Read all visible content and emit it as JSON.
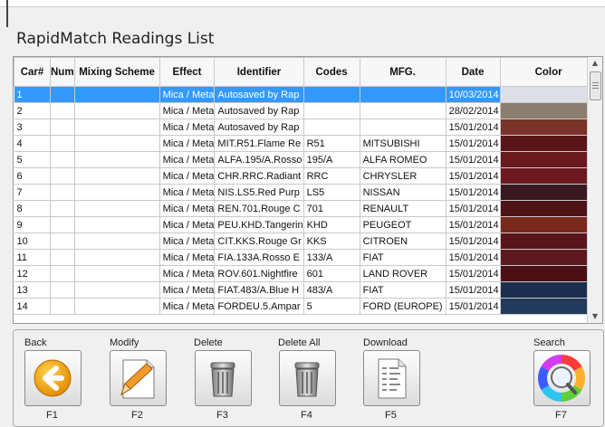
{
  "title": "RapidMatch Readings List",
  "columns": [
    "Car#",
    "Num",
    "Mixing Scheme",
    "Effect",
    "Identifier",
    "Codes",
    "MFG.",
    "Date",
    "Color"
  ],
  "rows": [
    {
      "car": "1",
      "num": "",
      "scheme": "",
      "effect": "Mica / Meta",
      "identifier": "Autosaved by Rap",
      "code": "",
      "mfg": "",
      "date": "10/03/2014",
      "color": "#dde0e8",
      "selected": true
    },
    {
      "car": "2",
      "num": "",
      "scheme": "",
      "effect": "Mica / Meta",
      "identifier": "Autosaved by Rap",
      "code": "",
      "mfg": "",
      "date": "28/02/2014",
      "color": "#8b7e6e",
      "selected": false
    },
    {
      "car": "3",
      "num": "",
      "scheme": "",
      "effect": "Mica / Meta",
      "identifier": "Autosaved by Rap",
      "code": "",
      "mfg": "",
      "date": "15/01/2014",
      "color": "#7a3328",
      "selected": false
    },
    {
      "car": "4",
      "num": "",
      "scheme": "",
      "effect": "Mica / Meta",
      "identifier": "MIT.R51.Flame Re",
      "code": "R51",
      "mfg": "MITSUBISHI",
      "date": "15/01/2014",
      "color": "#5a1518",
      "selected": false
    },
    {
      "car": "5",
      "num": "",
      "scheme": "",
      "effect": "Mica / Meta",
      "identifier": "ALFA.195/A.Rosso",
      "code": "195/A",
      "mfg": "ALFA ROMEO",
      "date": "15/01/2014",
      "color": "#6a1a1e",
      "selected": false
    },
    {
      "car": "6",
      "num": "",
      "scheme": "",
      "effect": "Mica / Meta",
      "identifier": "CHR.RRC.Radiant",
      "code": "RRC",
      "mfg": "CHRYSLER",
      "date": "15/01/2014",
      "color": "#6e1820",
      "selected": false
    },
    {
      "car": "7",
      "num": "",
      "scheme": "",
      "effect": "Mica / Meta",
      "identifier": "NIS.LS5.Red Purp",
      "code": "LS5",
      "mfg": "NISSAN",
      "date": "15/01/2014",
      "color": "#3a1820",
      "selected": false
    },
    {
      "car": "8",
      "num": "",
      "scheme": "",
      "effect": "Mica / Meta",
      "identifier": "REN.701.Rouge C",
      "code": "701",
      "mfg": "RENAULT",
      "date": "15/01/2014",
      "color": "#4e1418",
      "selected": false
    },
    {
      "car": "9",
      "num": "",
      "scheme": "",
      "effect": "Mica / Meta",
      "identifier": "PEU.KHD.Tangerin",
      "code": "KHD",
      "mfg": "PEUGEOT",
      "date": "15/01/2014",
      "color": "#7a2a1c",
      "selected": false
    },
    {
      "car": "10",
      "num": "",
      "scheme": "",
      "effect": "Mica / Meta",
      "identifier": "CIT.KKS.Rouge Gr",
      "code": "KKS",
      "mfg": "CITROEN",
      "date": "15/01/2014",
      "color": "#5a141c",
      "selected": false
    },
    {
      "car": "11",
      "num": "",
      "scheme": "",
      "effect": "Mica / Meta",
      "identifier": "FIA.133A.Rosso E",
      "code": "133/A",
      "mfg": "FIAT",
      "date": "15/01/2014",
      "color": "#5c1a20",
      "selected": false
    },
    {
      "car": "12",
      "num": "",
      "scheme": "",
      "effect": "Mica / Meta",
      "identifier": "ROV.601.Nightfire",
      "code": "601",
      "mfg": "LAND ROVER",
      "date": "15/01/2014",
      "color": "#4a1016",
      "selected": false
    },
    {
      "car": "13",
      "num": "",
      "scheme": "",
      "effect": "Mica / Meta",
      "identifier": "FIAT.483/A.Blue H",
      "code": "483/A",
      "mfg": "FIAT",
      "date": "15/01/2014",
      "color": "#1c2e4e",
      "selected": false
    },
    {
      "car": "14",
      "num": "",
      "scheme": "",
      "effect": "Mica / Meta",
      "identifier": "FORDEU.5.Ampar",
      "code": "5",
      "mfg": "FORD (EUROPE)",
      "date": "15/01/2014",
      "color": "#223a5c",
      "selected": false
    }
  ],
  "toolbar": [
    {
      "label": "Back",
      "key": "F1",
      "icon": "back-arrow-icon"
    },
    {
      "label": "Modify",
      "key": "F2",
      "icon": "modify-pencil-icon"
    },
    {
      "label": "Delete",
      "key": "F3",
      "icon": "trash-can-icon"
    },
    {
      "label": "Delete All",
      "key": "F4",
      "icon": "trash-can-icon"
    },
    {
      "label": "Download",
      "key": "F5",
      "icon": "download-document-icon"
    },
    {
      "label": "Search",
      "key": "F7",
      "icon": "color-wheel-search-icon"
    }
  ]
}
